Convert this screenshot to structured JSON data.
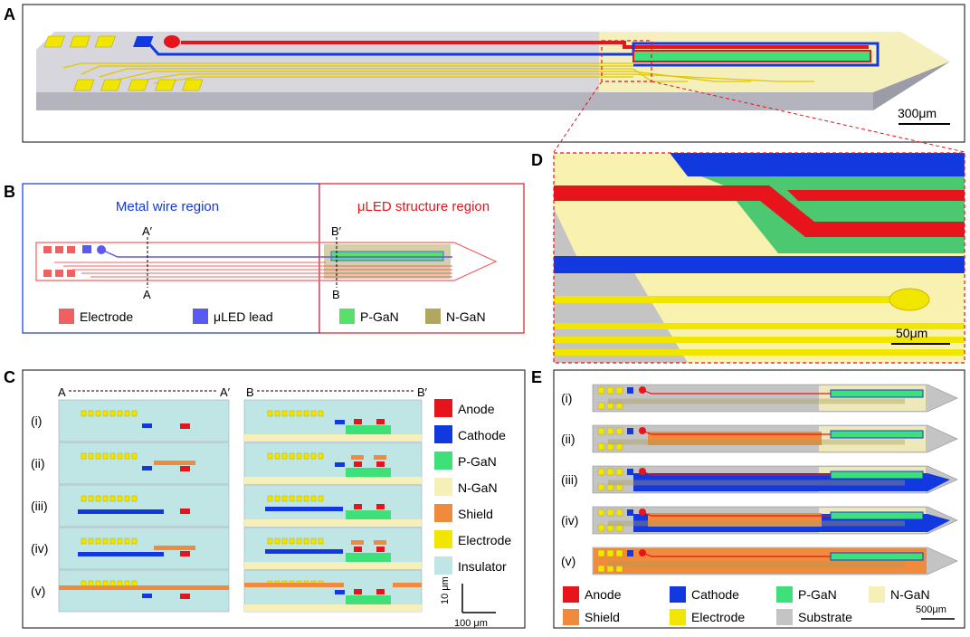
{
  "panels": {
    "A": {
      "letter": "A",
      "scale_bar": "300μm"
    },
    "B": {
      "letter": "B",
      "metal_region": "Metal wire region",
      "led_region": "μLED structure region",
      "cut_a": "A",
      "cut_a_prime": "A′",
      "cut_b": "B",
      "cut_b_prime": "B′",
      "legend": {
        "electrode": "Electrode",
        "led_lead": "μLED lead",
        "pgan": "P-GaN",
        "ngan": "N-GaN"
      }
    },
    "C": {
      "letter": "C",
      "axis_a": "A",
      "axis_a_prime": "A′",
      "axis_b": "B",
      "axis_b_prime": "B′",
      "rows": [
        "(i)",
        "(ii)",
        "(iii)",
        "(iv)",
        "(v)"
      ],
      "legend": [
        "Anode",
        "Cathode",
        "P-GaN",
        "N-GaN",
        "Shield",
        "Electrode",
        "Insulator"
      ],
      "scale_v": "10 μm",
      "scale_h": "100 μm"
    },
    "D": {
      "letter": "D",
      "scale_bar": "50μm"
    },
    "E": {
      "letter": "E",
      "rows": [
        "(i)",
        "(ii)",
        "(iii)",
        "(iv)",
        "(v)"
      ],
      "legend": [
        "Anode",
        "Cathode",
        "P-GaN",
        "N-GaN",
        "Shield",
        "Electrode",
        "Substrate"
      ],
      "scale_bar": "500μm"
    }
  },
  "colors": {
    "anode": "#e8141c",
    "cathode": "#1238e0",
    "pgan": "#3ee07a",
    "ngan": "#f6f0b8",
    "shield": "#f08a3c",
    "electrode": "#f0e600",
    "insulator": "#bfe6e4",
    "substrate": "#c4c4c4",
    "b_electrode": "#f06060",
    "b_led": "#5a5af0",
    "b_pgan": "#5ae06a",
    "b_ngan": "#b0a860"
  }
}
